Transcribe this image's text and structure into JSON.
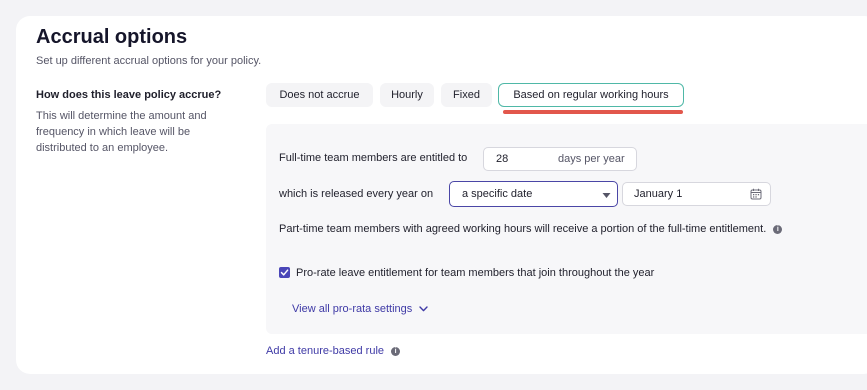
{
  "section": {
    "title": "Accrual options",
    "subtitle": "Set up different accrual options for your policy."
  },
  "question": {
    "label": "How does this leave policy accrue?",
    "description": "This will determine the amount and frequency in which leave will be distributed to an employee."
  },
  "accrual_types": [
    {
      "label": "Does not accrue",
      "selected": false
    },
    {
      "label": "Hourly",
      "selected": false
    },
    {
      "label": "Fixed",
      "selected": false
    },
    {
      "label": "Based on regular working hours",
      "selected": true
    }
  ],
  "entitlement": {
    "label": "Full-time team members are entitled to",
    "value": "28",
    "unit": "days per year"
  },
  "release": {
    "label": "which is released every year on",
    "frequency_selected": "a specific date",
    "date_value": "January 1"
  },
  "part_time_note": "Part-time team members with agreed working hours will receive a portion of the full-time entitlement.",
  "prorate": {
    "checked": true,
    "label": "Pro-rate leave entitlement for team members that join throughout the year",
    "view_all_label": "View all pro-rata settings"
  },
  "tenure_rule_label": "Add a tenure-based rule",
  "colors": {
    "accent": "#4a46b8",
    "selected_border": "#4fb8a7",
    "annotation_underline": "#e2574c"
  },
  "icons": {
    "info": "info-icon",
    "calendar": "calendar-icon",
    "dropdown": "caret-down-icon",
    "chevron": "chevron-down-icon",
    "check": "check-icon"
  }
}
